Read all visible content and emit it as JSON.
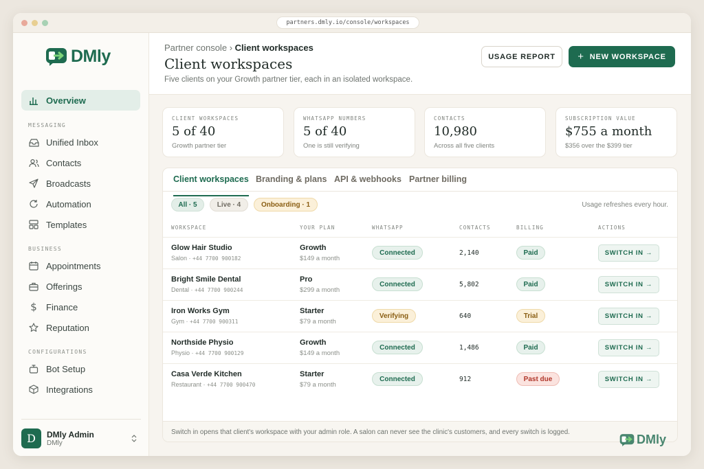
{
  "browser": {
    "url": "partners.dmly.io/console/workspaces"
  },
  "brand": {
    "name": "DMly",
    "color": "#1e6b50"
  },
  "sidebar": {
    "overview": "Overview",
    "sections": {
      "messaging": "MESSAGING",
      "business": "BUSINESS",
      "configurations": "CONFIGURATIONS"
    },
    "messaging_items": [
      "Unified Inbox",
      "Contacts",
      "Broadcasts",
      "Automation",
      "Templates"
    ],
    "business_items": [
      "Appointments",
      "Offerings",
      "Finance",
      "Reputation"
    ],
    "config_items": [
      "Bot Setup",
      "Integrations"
    ],
    "user": {
      "initial": "D",
      "name": "DMly Admin",
      "org": "DMly"
    }
  },
  "header": {
    "breadcrumb_parent": "Partner console",
    "breadcrumb_current": "Client workspaces",
    "title": "Client workspaces",
    "subtitle": "Five clients on your Growth partner tier, each in an isolated workspace.",
    "usage_report": "USAGE REPORT",
    "new_workspace": "NEW WORKSPACE"
  },
  "stats": [
    {
      "label": "CLIENT WORKSPACES",
      "value": "5 of 40",
      "note": "Growth partner tier"
    },
    {
      "label": "WHATSAPP NUMBERS",
      "value": "5 of 40",
      "note": "One is still verifying"
    },
    {
      "label": "CONTACTS",
      "value": "10,980",
      "note": "Across all five clients"
    },
    {
      "label": "SUBSCRIPTION VALUE",
      "value": "$755 a month",
      "note": "$356 over the $399 tier"
    }
  ],
  "tabs": [
    "Client workspaces",
    "Branding & plans",
    "API & webhooks",
    "Partner billing"
  ],
  "filters": [
    "All · 5",
    "Live · 4",
    "Onboarding · 1"
  ],
  "refresh_note": "Usage refreshes every hour.",
  "table": {
    "headers": [
      "WORKSPACE",
      "YOUR PLAN",
      "WHATSAPP",
      "CONTACTS",
      "BILLING",
      "ACTIONS"
    ],
    "rows": [
      {
        "name": "Glow Hair Studio",
        "type": "Salon",
        "phone": "+44 7700 900182",
        "plan": "Growth",
        "price": "$149 a month",
        "whatsapp": "Connected",
        "contacts": "2,140",
        "billing": "Paid",
        "action": "SWITCH IN"
      },
      {
        "name": "Bright Smile Dental",
        "type": "Dental",
        "phone": "+44 7700 900244",
        "plan": "Pro",
        "price": "$299 a month",
        "whatsapp": "Connected",
        "contacts": "5,802",
        "billing": "Paid",
        "action": "SWITCH IN"
      },
      {
        "name": "Iron Works Gym",
        "type": "Gym",
        "phone": "+44 7700 900311",
        "plan": "Starter",
        "price": "$79 a month",
        "whatsapp": "Verifying",
        "contacts": "640",
        "billing": "Trial",
        "action": "SWITCH IN"
      },
      {
        "name": "Northside Physio",
        "type": "Physio",
        "phone": "+44 7700 900129",
        "plan": "Growth",
        "price": "$149 a month",
        "whatsapp": "Connected",
        "contacts": "1,486",
        "billing": "Paid",
        "action": "SWITCH IN"
      },
      {
        "name": "Casa Verde Kitchen",
        "type": "Restaurant",
        "phone": "+44 7700 900470",
        "plan": "Starter",
        "price": "$79 a month",
        "whatsapp": "Connected",
        "contacts": "912",
        "billing": "Past due",
        "action": "SWITCH IN"
      }
    ]
  },
  "footer": "Switch in opens that client's workspace with your admin role. A salon can never see the clinic's customers, and every switch is logged."
}
